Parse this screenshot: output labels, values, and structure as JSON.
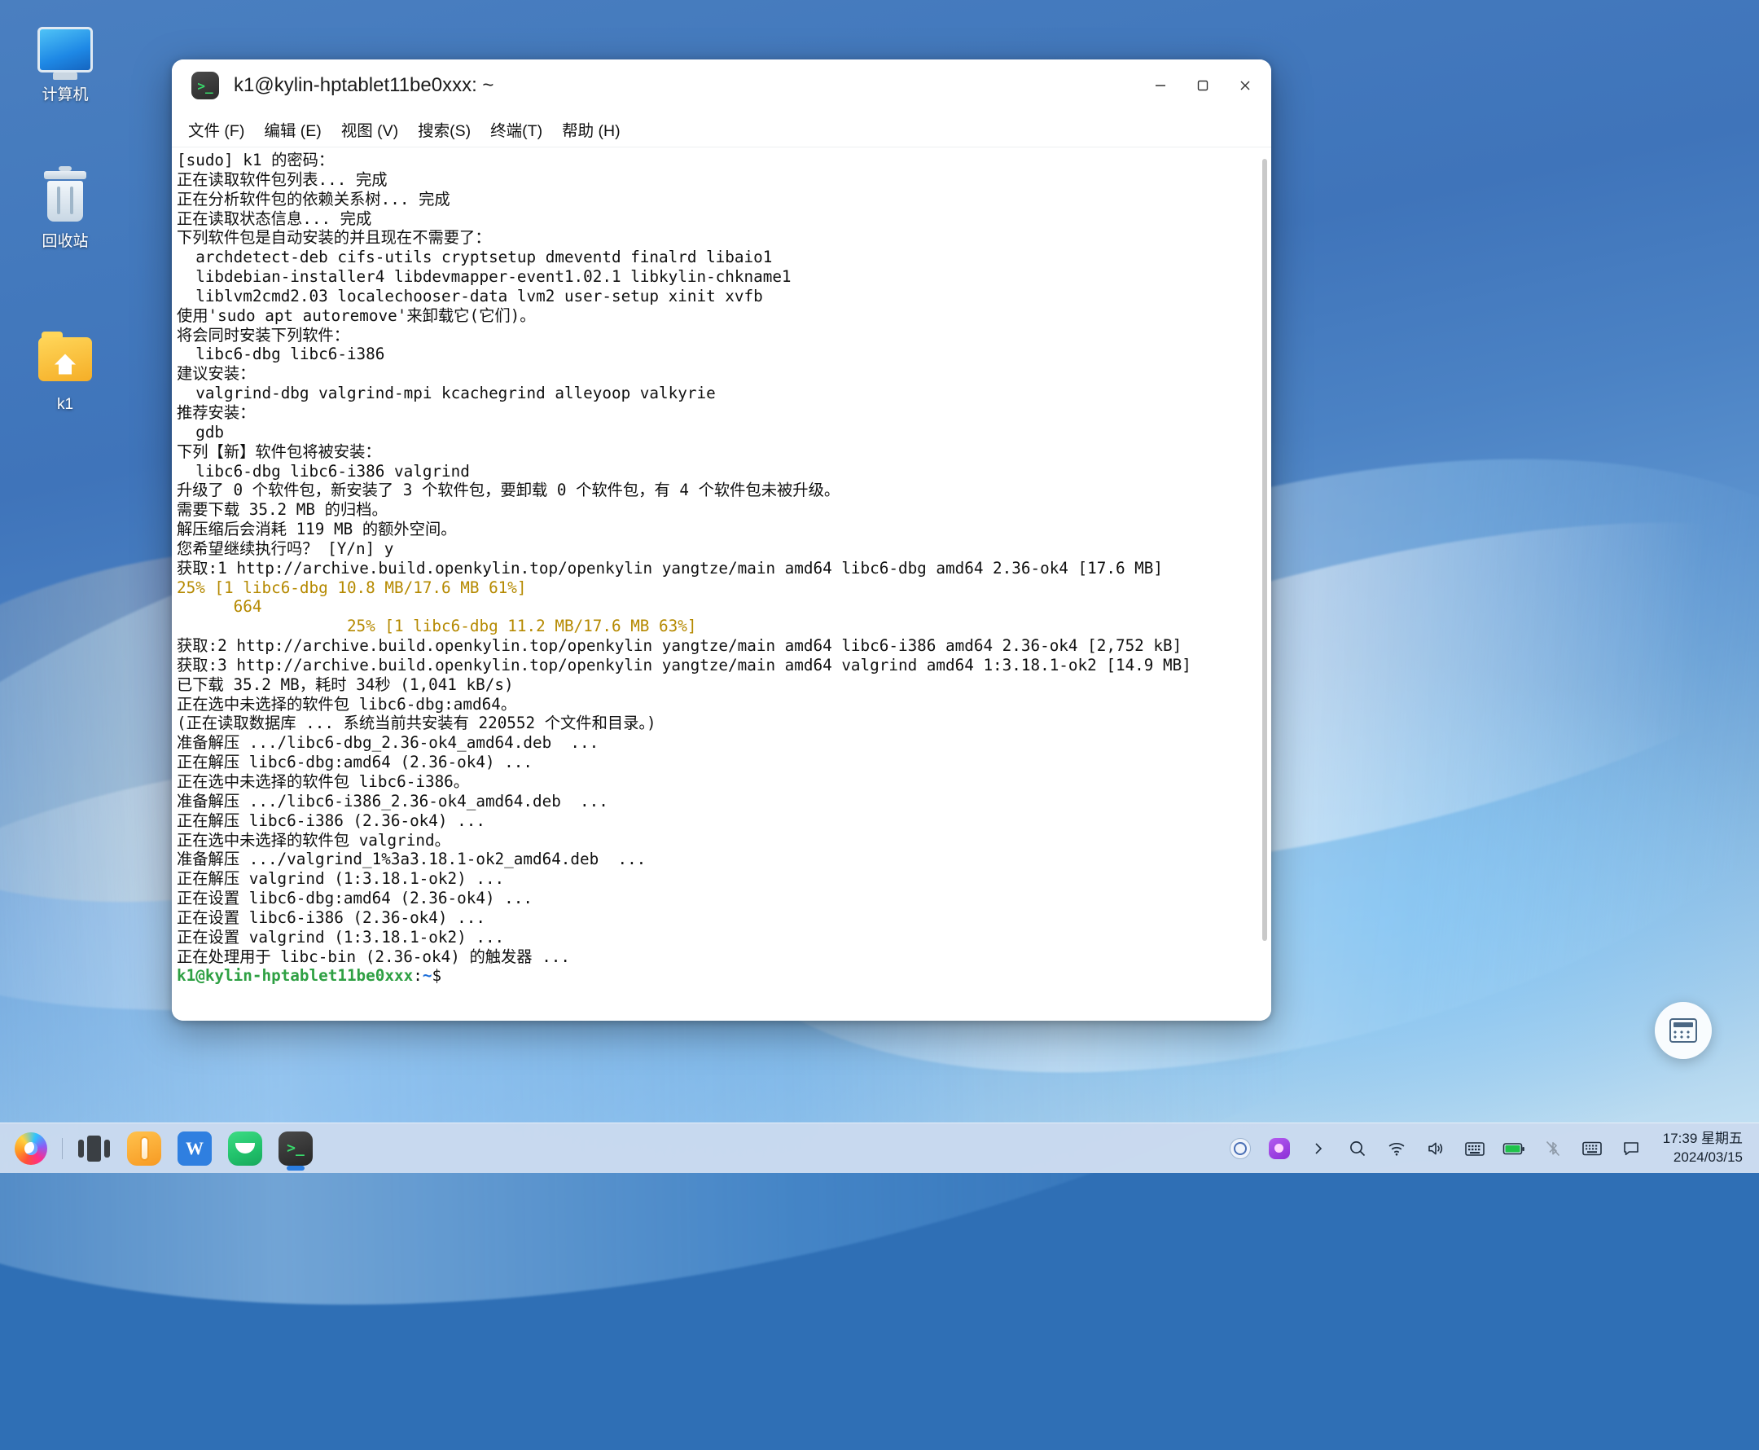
{
  "desktop": {
    "icons": [
      {
        "name": "computer",
        "label": "计算机",
        "icon": "monitor-icon"
      },
      {
        "name": "recycle-bin",
        "label": "回收站",
        "icon": "trash-icon"
      },
      {
        "name": "home-folder",
        "label": "k1",
        "icon": "folder-icon"
      }
    ]
  },
  "window": {
    "title": "k1@kylin-hptablet11be0xxx: ~",
    "app_icon": ">_",
    "controls": {
      "minimize": "minimize-icon",
      "maximize": "maximize-icon",
      "close": "close-icon"
    },
    "menu": [
      {
        "name": "file",
        "label": "文件 (F)"
      },
      {
        "name": "edit",
        "label": "编辑 (E)"
      },
      {
        "name": "view",
        "label": "视图 (V)"
      },
      {
        "name": "search",
        "label": "搜索(S)"
      },
      {
        "name": "terminal",
        "label": "终端(T)"
      },
      {
        "name": "help",
        "label": "帮助 (H)"
      }
    ]
  },
  "terminal": {
    "lines": [
      {
        "text": "[sudo] k1 的密码：",
        "color": "default"
      },
      {
        "text": "正在读取软件包列表... 完成",
        "color": "default"
      },
      {
        "text": "正在分析软件包的依赖关系树... 完成",
        "color": "default"
      },
      {
        "text": "正在读取状态信息... 完成",
        "color": "default"
      },
      {
        "text": "下列软件包是自动安装的并且现在不需要了：",
        "color": "default"
      },
      {
        "text": "  archdetect-deb cifs-utils cryptsetup dmeventd finalrd libaio1",
        "color": "default"
      },
      {
        "text": "  libdebian-installer4 libdevmapper-event1.02.1 libkylin-chkname1",
        "color": "default"
      },
      {
        "text": "  liblvm2cmd2.03 localechooser-data lvm2 user-setup xinit xvfb",
        "color": "default"
      },
      {
        "text": "使用'sudo apt autoremove'来卸载它(它们)。",
        "color": "default"
      },
      {
        "text": "将会同时安装下列软件：",
        "color": "default"
      },
      {
        "text": "  libc6-dbg libc6-i386",
        "color": "default"
      },
      {
        "text": "建议安装：",
        "color": "default"
      },
      {
        "text": "  valgrind-dbg valgrind-mpi kcachegrind alleyoop valkyrie",
        "color": "default"
      },
      {
        "text": "推荐安装：",
        "color": "default"
      },
      {
        "text": "  gdb",
        "color": "default"
      },
      {
        "text": "下列【新】软件包将被安装：",
        "color": "default"
      },
      {
        "text": "  libc6-dbg libc6-i386 valgrind",
        "color": "default"
      },
      {
        "text": "升级了 0 个软件包，新安装了 3 个软件包，要卸载 0 个软件包，有 4 个软件包未被升级。",
        "color": "default"
      },
      {
        "text": "需要下载 35.2 MB 的归档。",
        "color": "default"
      },
      {
        "text": "解压缩后会消耗 119 MB 的额外空间。",
        "color": "default"
      },
      {
        "text": "您希望继续执行吗？ [Y/n] y",
        "color": "default"
      },
      {
        "text": "获取:1 http://archive.build.openkylin.top/openkylin yangtze/main amd64 libc6-dbg amd64 2.36-ok4 [17.6 MB]",
        "color": "default"
      },
      {
        "text": "25% [1 libc6-dbg 10.8 MB/17.6 MB 61%]",
        "color": "yellow"
      },
      {
        "text": "      664",
        "color": "yellow"
      },
      {
        "text": "                  25% [1 libc6-dbg 11.2 MB/17.6 MB 63%]",
        "color": "yellow"
      },
      {
        "text": "获取:2 http://archive.build.openkylin.top/openkylin yangtze/main amd64 libc6-i386 amd64 2.36-ok4 [2,752 kB]",
        "color": "default"
      },
      {
        "text": "获取:3 http://archive.build.openkylin.top/openkylin yangtze/main amd64 valgrind amd64 1:3.18.1-ok2 [14.9 MB]",
        "color": "default"
      },
      {
        "text": "已下载 35.2 MB，耗时 34秒 (1,041 kB/s)",
        "color": "default"
      },
      {
        "text": "正在选中未选择的软件包 libc6-dbg:amd64。",
        "color": "default"
      },
      {
        "text": "(正在读取数据库 ... 系统当前共安装有 220552 个文件和目录。)",
        "color": "default"
      },
      {
        "text": "准备解压 .../libc6-dbg_2.36-ok4_amd64.deb  ...",
        "color": "default"
      },
      {
        "text": "正在解压 libc6-dbg:amd64 (2.36-ok4) ...",
        "color": "default"
      },
      {
        "text": "正在选中未选择的软件包 libc6-i386。",
        "color": "default"
      },
      {
        "text": "准备解压 .../libc6-i386_2.36-ok4_amd64.deb  ...",
        "color": "default"
      },
      {
        "text": "正在解压 libc6-i386 (2.36-ok4) ...",
        "color": "default"
      },
      {
        "text": "正在选中未选择的软件包 valgrind。",
        "color": "default"
      },
      {
        "text": "准备解压 .../valgrind_1%3a3.18.1-ok2_amd64.deb  ...",
        "color": "default"
      },
      {
        "text": "正在解压 valgrind (1:3.18.1-ok2) ...",
        "color": "default"
      },
      {
        "text": "正在设置 libc6-dbg:amd64 (2.36-ok4) ...",
        "color": "default"
      },
      {
        "text": "正在设置 libc6-i386 (2.36-ok4) ...",
        "color": "default"
      },
      {
        "text": "正在设置 valgrind (1:3.18.1-ok2) ...",
        "color": "default"
      },
      {
        "text": "正在处理用于 libc-bin (2.36-ok4) 的触发器 ...",
        "color": "default"
      }
    ],
    "prompt": {
      "user_host": "k1@kylin-hptablet11be0xxx",
      "separator": ":",
      "path": "~",
      "symbol": "$"
    },
    "colors": {
      "text": "#101010",
      "progress_yellow": "#b58900",
      "prompt_green": "#2ea043",
      "prompt_blue": "#1e6fd9",
      "background": "#ffffff"
    }
  },
  "widget": {
    "name": "calculator-widget",
    "icon": "calculator-icon"
  },
  "taskbar": {
    "apps": [
      {
        "name": "firefox",
        "icon": "firefox-icon",
        "active": false
      },
      {
        "name": "task-view",
        "icon": "task-view-icon",
        "active": false
      },
      {
        "name": "app-store",
        "icon": "app-store-icon",
        "active": false
      },
      {
        "name": "wps-office",
        "icon": "wps-icon",
        "label": "W",
        "active": false
      },
      {
        "name": "mail",
        "icon": "mail-icon",
        "active": false
      },
      {
        "name": "terminal",
        "icon": "terminal-icon",
        "label": ">_",
        "active": true
      }
    ],
    "tray": [
      {
        "name": "security-center",
        "icon": "security-icon"
      },
      {
        "name": "screen-recorder",
        "icon": "recorder-icon"
      },
      {
        "name": "tray-expand",
        "icon": "chevron-right-icon"
      },
      {
        "name": "search",
        "icon": "search-icon"
      },
      {
        "name": "network",
        "icon": "wifi-icon"
      },
      {
        "name": "volume",
        "icon": "speaker-icon"
      },
      {
        "name": "input-method",
        "icon": "keyboard-icon"
      },
      {
        "name": "battery",
        "icon": "battery-icon"
      },
      {
        "name": "bluetooth",
        "icon": "bluetooth-off-icon"
      },
      {
        "name": "onscreen-keyboard",
        "icon": "osk-icon"
      },
      {
        "name": "notifications",
        "icon": "message-icon"
      }
    ],
    "clock": {
      "time": "17:39 星期五",
      "date": "2024/03/15"
    }
  }
}
